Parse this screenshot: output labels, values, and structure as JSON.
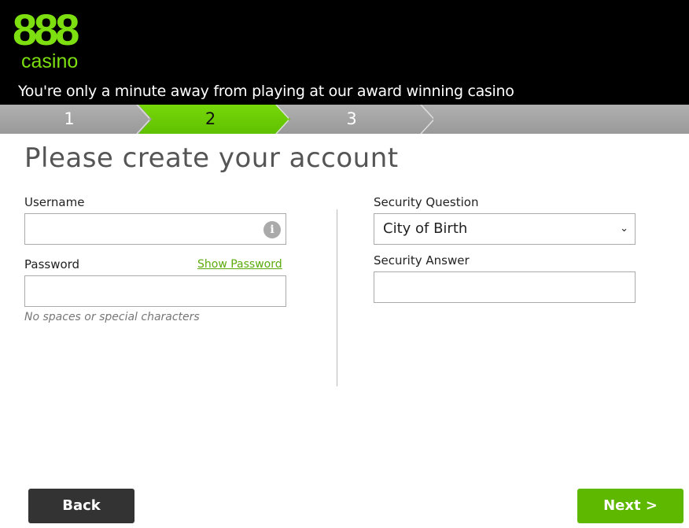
{
  "header": {
    "logo_number": "888",
    "logo_word": "casino",
    "tagline": "You're only a minute away from playing at our award winning casino"
  },
  "steps": [
    {
      "label": "1",
      "active": false
    },
    {
      "label": "2",
      "active": true
    },
    {
      "label": "3",
      "active": false
    }
  ],
  "title": "Please create your account",
  "form": {
    "username_label": "Username",
    "username_value": "",
    "password_label": "Password",
    "show_password": "Show Password",
    "password_value": "",
    "password_hint": "No spaces or special characters",
    "security_question_label": "Security Question",
    "security_question_value": "City of Birth",
    "security_answer_label": "Security Answer",
    "security_answer_value": ""
  },
  "buttons": {
    "back": "Back",
    "next": "Next >"
  },
  "colors": {
    "brand_green": "#7ddf0f",
    "next_button": "#5fb800",
    "back_button": "#333333"
  }
}
